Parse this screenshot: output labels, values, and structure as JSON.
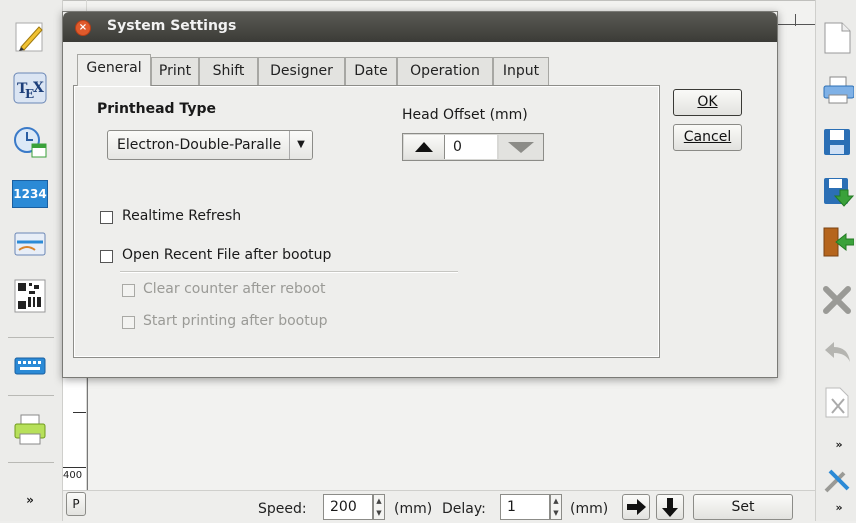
{
  "dialog": {
    "title": "System Settings",
    "tabs": [
      {
        "label": "General",
        "active": true
      },
      {
        "label": "Print",
        "active": false
      },
      {
        "label": "Shift",
        "active": false
      },
      {
        "label": "Designer",
        "active": false
      },
      {
        "label": "Date",
        "active": false
      },
      {
        "label": "Operation",
        "active": false
      },
      {
        "label": "Input",
        "active": false
      }
    ],
    "ok_label": "OK",
    "cancel_label": "Cancel",
    "printhead_type_label": "Printhead Type",
    "printhead_type_value": "Electron-Double-Paralle",
    "head_offset_label": "Head Offset (mm)",
    "head_offset_value": "0",
    "options": {
      "realtime_refresh": {
        "label": "Realtime Refresh",
        "checked": false,
        "enabled": true
      },
      "open_recent_file": {
        "label": "Open Recent File after bootup",
        "checked": false,
        "enabled": true
      },
      "clear_counter": {
        "label": "Clear counter after reboot",
        "checked": false,
        "enabled": false
      },
      "start_printing": {
        "label": "Start printing after bootup",
        "checked": false,
        "enabled": false
      }
    }
  },
  "left_toolbar": {
    "icons": [
      "pencil-icon",
      "tex-icon",
      "clock-calendar-icon",
      "counter-1234-icon",
      "image-card-icon",
      "barcode-icon",
      "keyboard-icon",
      "printer-icon",
      "chevron-down-icon"
    ],
    "counter_text": "1234"
  },
  "right_toolbar": {
    "icons": [
      "new-file-icon",
      "print-icon",
      "save-icon",
      "save-as-icon",
      "exit-icon",
      "delete-icon",
      "undo-icon",
      "cut-icon",
      "chevron-down-icon",
      "tools-icon",
      "chevron-down-icon"
    ]
  },
  "canvas": {
    "ruler_value": "400",
    "p_button_label": "P"
  },
  "bottom_bar": {
    "speed_label": "Speed:",
    "speed_value": "200",
    "speed_unit": "(mm)",
    "delay_label": "Delay:",
    "delay_value": "1",
    "delay_unit": "(mm)",
    "set_label": "Set"
  },
  "colors": {
    "window_bg": "#eeeeec",
    "titlebar": "#3b3b37",
    "close_button": "#e05a2b",
    "accent_blue": "#2b8ad6",
    "accent_green": "#3aa13a"
  }
}
